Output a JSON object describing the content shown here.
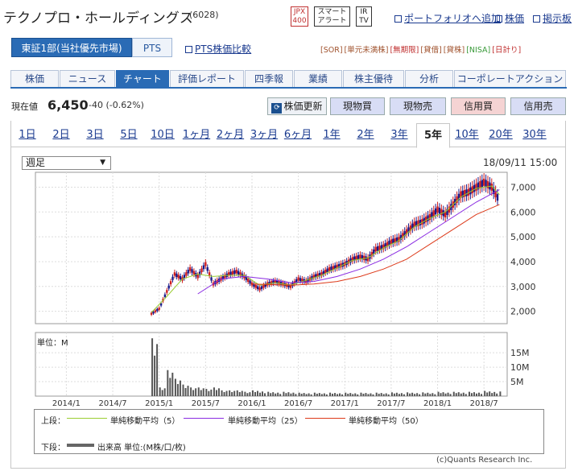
{
  "company": {
    "name": "テクノプロ・ホールディングス",
    "code": "(6028)"
  },
  "badges": [
    {
      "line1": "JPX",
      "line2": "400",
      "color": "#c03030"
    },
    {
      "line1": "スマート",
      "line2": "アラート",
      "color": "#333333"
    },
    {
      "line1": "IR",
      "line2": "TV",
      "color": "#333333"
    }
  ],
  "header_links": {
    "portfolio": "ポートフォリオへ追加",
    "stock": "株価",
    "board": "掲示板"
  },
  "market": {
    "selected": "東証1部(当社優先市場)",
    "pts": "PTS",
    "compare": "PTS株価比較"
  },
  "tags": [
    "[SOR]",
    "[単元未満株]",
    "[無期限]",
    "[貸借]",
    "[貸株]",
    "[NISA]",
    "[日計り]"
  ],
  "nav_tabs": [
    "株価",
    "ニュース",
    "チャート",
    "評価レポート",
    "四季報",
    "業績",
    "株主優待",
    "分析",
    "コーポレートアクション"
  ],
  "nav_active": 2,
  "price": {
    "label": "現在値",
    "value": "6,450",
    "change": "-40 (-0.62%)"
  },
  "actions": {
    "refresh": "株価更新",
    "buy_spot": "現物買",
    "sell_spot": "現物売",
    "buy_margin": "信用買",
    "sell_margin": "信用売"
  },
  "periods": [
    "1日",
    "2日",
    "3日",
    "5日",
    "10日",
    "1ヶ月",
    "2ヶ月",
    "3ヶ月",
    "6ヶ月",
    "1年",
    "2年",
    "3年",
    "5年",
    "10年",
    "20年",
    "30年"
  ],
  "period_active": 12,
  "interval_select": "週足",
  "as_of": "18/09/11 15:00",
  "volume_unit": "単位：M",
  "legend": {
    "upper": "上段：",
    "lower": "下段：",
    "ma5": "単純移動平均（5）",
    "ma25": "単純移動平均（25）",
    "ma50": "単純移動平均（50）",
    "volume": "出来高 単位:(M株/口/枚)"
  },
  "copyright": "(c)Quants Research Inc.",
  "colors": {
    "ma5": "#9acd32",
    "ma25": "#8a2be2",
    "ma50": "#dd3a1a",
    "up": "#d02020",
    "down": "#1a1a8a",
    "volume": "#555555"
  },
  "chart_data": {
    "type": "line",
    "price_axis": {
      "ticks": [
        "2,000",
        "3,000",
        "4,000",
        "5,000",
        "6,000",
        "7,000"
      ],
      "ylim": [
        1500,
        7600
      ]
    },
    "volume_axis": {
      "ticks": [
        "5M",
        "10M",
        "15M"
      ],
      "ylim": [
        0,
        22
      ]
    },
    "x_ticks": [
      "2014/1",
      "2014/7",
      "2015/1",
      "2015/7",
      "2016/1",
      "2016/7",
      "2017/1",
      "2017/7",
      "2018/1",
      "2018/7"
    ],
    "xlim": [
      "2013/9",
      "2018/10"
    ],
    "series": [
      {
        "name": "price",
        "x": [
          "2014/12",
          "2015/1",
          "2015/2",
          "2015/3",
          "2015/4",
          "2015/5",
          "2015/6",
          "2015/7",
          "2015/8",
          "2015/9",
          "2015/10",
          "2015/11",
          "2015/12",
          "2016/1",
          "2016/2",
          "2016/3",
          "2016/4",
          "2016/5",
          "2016/6",
          "2016/7",
          "2016/8",
          "2016/9",
          "2016/10",
          "2016/11",
          "2016/12",
          "2017/1",
          "2017/2",
          "2017/3",
          "2017/4",
          "2017/5",
          "2017/6",
          "2017/7",
          "2017/8",
          "2017/9",
          "2017/10",
          "2017/11",
          "2017/12",
          "2018/1",
          "2018/2",
          "2018/3",
          "2018/4",
          "2018/5",
          "2018/6",
          "2018/7",
          "2018/8",
          "2018/9"
        ],
        "values": [
          1900,
          2100,
          2800,
          3500,
          3300,
          3700,
          3400,
          3900,
          3100,
          3300,
          3500,
          3600,
          3400,
          3100,
          2900,
          3100,
          3200,
          3100,
          3000,
          3300,
          3200,
          3400,
          3500,
          3700,
          3800,
          3900,
          4100,
          4200,
          4100,
          4500,
          4600,
          4800,
          4900,
          5200,
          5500,
          5600,
          5800,
          6100,
          5900,
          6300,
          6700,
          6800,
          7000,
          7200,
          7000,
          6450
        ]
      },
      {
        "name": "単純移動平均（5）",
        "x": [
          "2014/12",
          "2015/2",
          "2015/4",
          "2015/6",
          "2015/8",
          "2015/10",
          "2015/12",
          "2016/2",
          "2016/4",
          "2016/6",
          "2016/8",
          "2016/10",
          "2016/12",
          "2017/2",
          "2017/4",
          "2017/6",
          "2017/8",
          "2017/10",
          "2017/12",
          "2018/2",
          "2018/4",
          "2018/6",
          "2018/8",
          "2018/9"
        ],
        "values": [
          1950,
          2600,
          3300,
          3500,
          3400,
          3450,
          3450,
          3050,
          3150,
          3050,
          3250,
          3450,
          3750,
          4050,
          4150,
          4550,
          4850,
          5400,
          5750,
          6000,
          6600,
          6950,
          7050,
          6700
        ]
      },
      {
        "name": "単純移動平均（25）",
        "x": [
          "2015/6",
          "2015/9",
          "2015/12",
          "2016/3",
          "2016/6",
          "2016/9",
          "2016/12",
          "2017/3",
          "2017/6",
          "2017/9",
          "2017/12",
          "2018/3",
          "2018/6",
          "2018/9"
        ],
        "values": [
          2700,
          3300,
          3400,
          3300,
          3150,
          3200,
          3400,
          3700,
          4100,
          4600,
          5200,
          5800,
          6400,
          6900
        ]
      },
      {
        "name": "単純移動平均（50）",
        "x": [
          "2016/1",
          "2016/6",
          "2016/9",
          "2016/12",
          "2017/3",
          "2017/6",
          "2017/9",
          "2017/12",
          "2018/3",
          "2018/6",
          "2018/9"
        ],
        "values": [
          3100,
          3050,
          3100,
          3200,
          3400,
          3700,
          4100,
          4700,
          5300,
          5900,
          6300
        ]
      }
    ],
    "volume": {
      "x": [
        "2014/12",
        "2015/1",
        "2015/2",
        "2015/3",
        "2015/4",
        "2015/5",
        "2015/6",
        "2015/7",
        "2015/8",
        "2015/9",
        "2015/10",
        "2015/11",
        "2015/12",
        "2016/1",
        "2016/3",
        "2016/5",
        "2016/7",
        "2016/9",
        "2016/11",
        "2017/1",
        "2017/3",
        "2017/5",
        "2017/7",
        "2017/9",
        "2017/11",
        "2018/1",
        "2018/3",
        "2018/5",
        "2018/7",
        "2018/9"
      ],
      "values": [
        20,
        3,
        9,
        6,
        4,
        3,
        3,
        2.5,
        3,
        2,
        2,
        2,
        1.5,
        2,
        1.5,
        1.5,
        1.2,
        1.2,
        1.2,
        1.2,
        1.2,
        1.2,
        1.3,
        1.3,
        1.3,
        1.5,
        1.5,
        1.5,
        1.8,
        1.6
      ]
    }
  }
}
